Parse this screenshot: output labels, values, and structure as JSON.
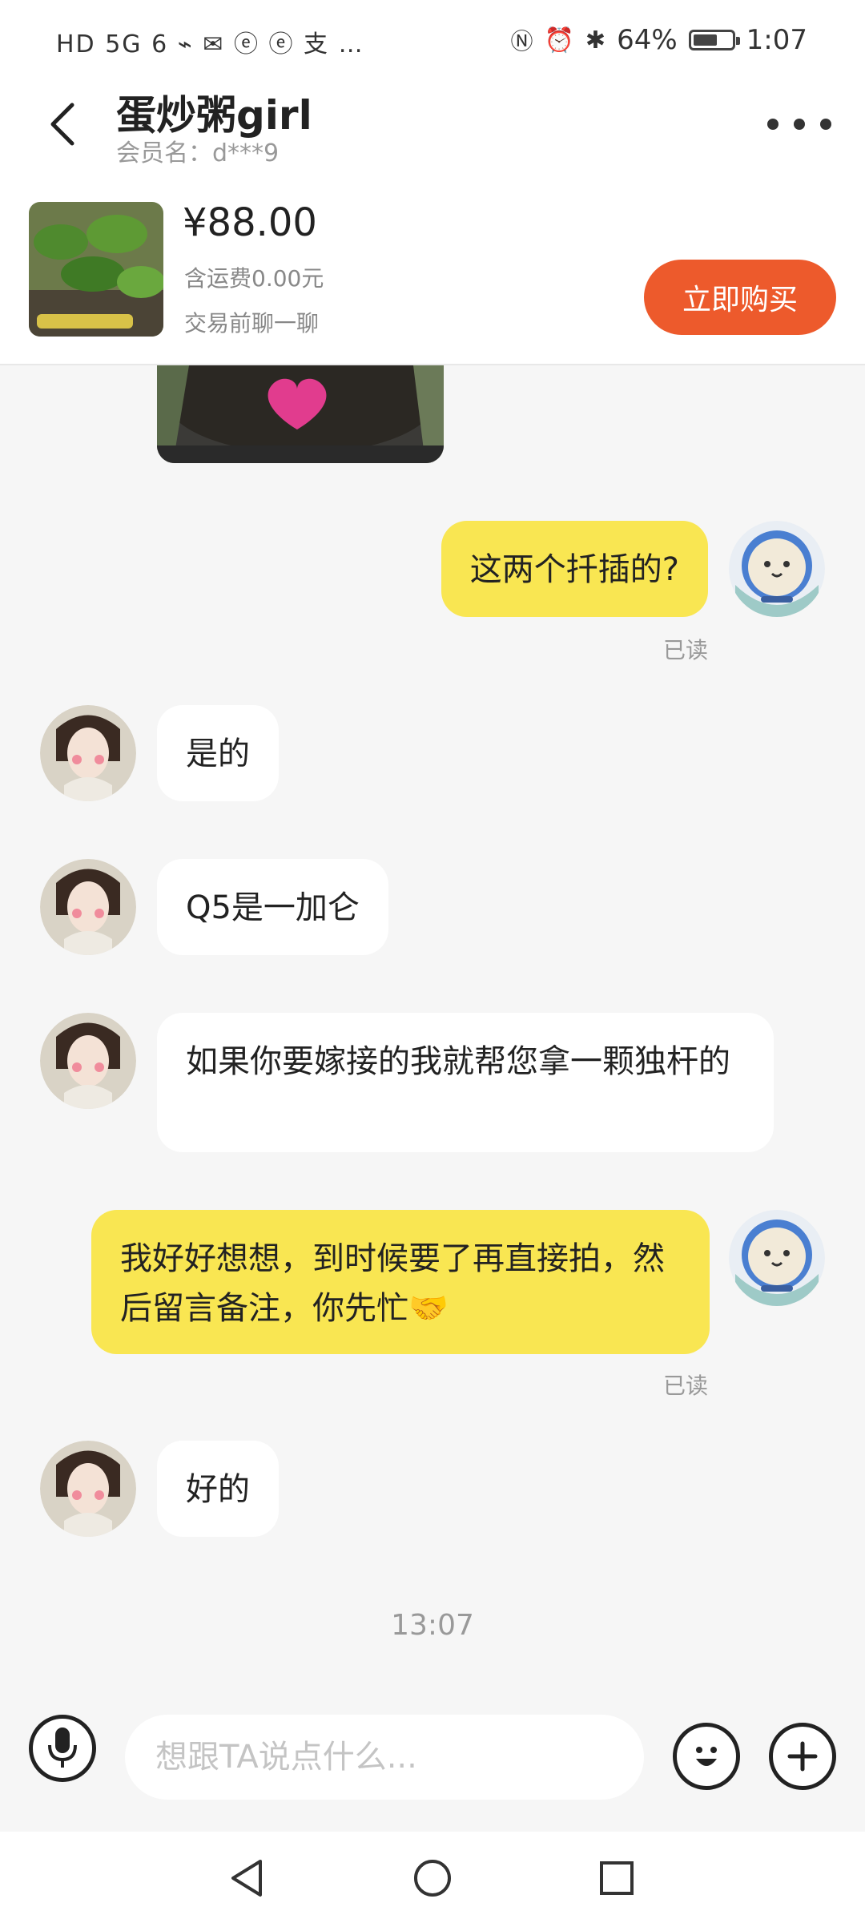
{
  "status_bar": {
    "left_icons": "HD 5G 6 ⌁ ✉ ⓔ ⓔ 支 …",
    "battery_percent": "64%",
    "time": "1:07",
    "battery_level": 0.64
  },
  "header": {
    "shop_name": "蛋炒粥girl",
    "member_name": "会员名：d***9"
  },
  "product": {
    "price": "¥88.00",
    "shipping": "含运费0.00元",
    "chat_before_trade": "交易前聊一聊",
    "buy_label": "立即购买"
  },
  "messages": [
    {
      "side": "mine",
      "text": "这两个扦插的?",
      "read": "已读"
    },
    {
      "side": "theirs",
      "text": "是的"
    },
    {
      "side": "theirs",
      "text": "Q5是一加仑"
    },
    {
      "side": "theirs",
      "text": "如果你要嫁接的我就帮您拿一颗独杆的"
    },
    {
      "side": "mine",
      "text": "我好好想想，到时候要了再直接拍，然后留言备注，你先忙🤝",
      "read": "已读"
    },
    {
      "side": "theirs",
      "text": "好的"
    }
  ],
  "timestamp": "13:07",
  "input": {
    "placeholder": "想跟TA说点什么..."
  },
  "icons": {
    "back": "chevron-left-icon",
    "more": "more-icon",
    "voice": "microphone-icon",
    "emoji": "emoji-icon",
    "plus": "plus-icon",
    "nav_back": "triangle-back-icon",
    "nav_home": "circle-home-icon",
    "nav_recent": "square-recent-icon"
  },
  "colors": {
    "accent": "#ed5a2c",
    "my_bubble": "#f9e652",
    "their_bubble": "#ffffff",
    "background": "#f6f6f6"
  }
}
